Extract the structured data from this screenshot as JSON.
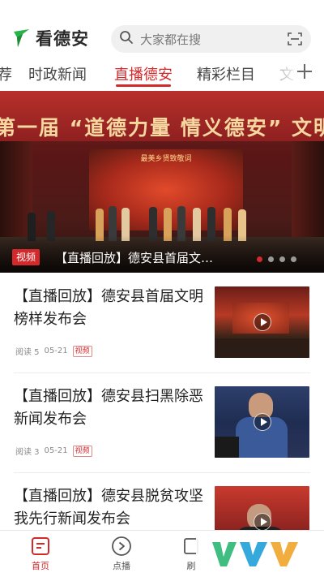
{
  "app": {
    "name": "看德安",
    "brand_color": "#d4292b",
    "logo_color": "#29b34a"
  },
  "search": {
    "placeholder": "大家都在搜",
    "icon": "search-icon",
    "scan_icon": "scan-icon"
  },
  "tabs": [
    {
      "label": "荐",
      "active": false
    },
    {
      "label": "时政新闻",
      "active": false
    },
    {
      "label": "直播德安",
      "active": true
    },
    {
      "label": "精彩栏目",
      "active": false
    },
    {
      "label": "文",
      "active": false
    }
  ],
  "banner": {
    "heading": "第一届 “道德力量 情义德安” 文明榜样发布",
    "stage_caption": "最美乡贤致敬词",
    "badge": "视频",
    "title": "【直播回放】德安县首届文…",
    "slide_count": 4,
    "active_slide": 1
  },
  "news": [
    {
      "title": "【直播回放】德安县首届文明榜样发布会",
      "reads": "阅读 5",
      "date": "05-21",
      "tag": "视频"
    },
    {
      "title": "【直播回放】德安县扫黑除恶新闻发布会",
      "reads": "阅读 3",
      "date": "05-21",
      "tag": "视频"
    },
    {
      "title": "【直播回放】德安县脱贫攻坚我先行新闻发布会",
      "reads": "",
      "date": "",
      "tag": ""
    }
  ],
  "bottom_nav": [
    {
      "label": "首页",
      "icon": "home-icon",
      "active": true
    },
    {
      "label": "点播",
      "icon": "play-circle-icon",
      "active": false
    },
    {
      "label": "刷",
      "icon": "refresh-icon",
      "active": false
    }
  ]
}
